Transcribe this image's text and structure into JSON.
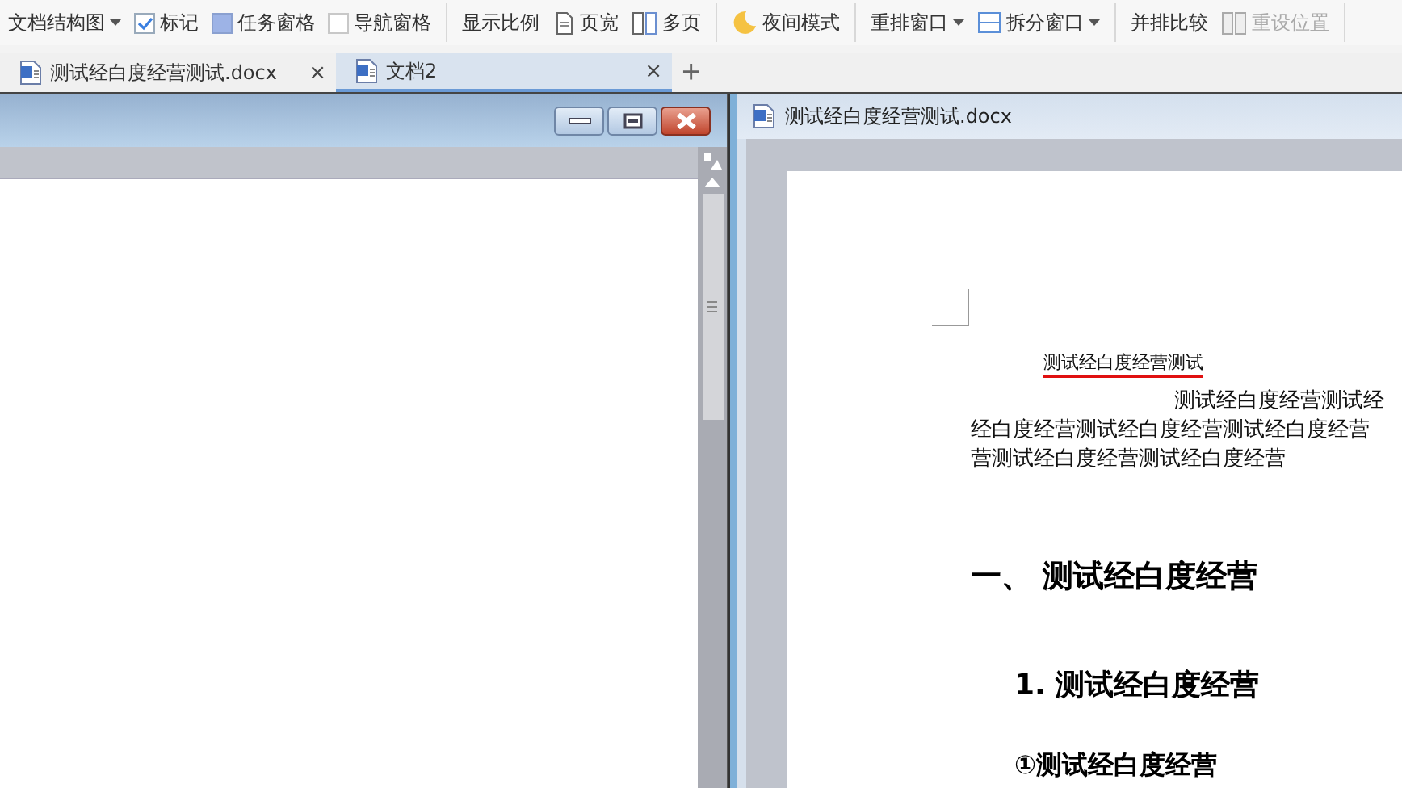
{
  "toolbar": {
    "items": [
      {
        "kind": "dropdown",
        "label": "文档结构图"
      },
      {
        "kind": "checkbox",
        "label": "标记",
        "checked": true
      },
      {
        "kind": "toggle",
        "label": "任务窗格",
        "on": true
      },
      {
        "kind": "checkbox",
        "label": "导航窗格",
        "checked": false
      },
      {
        "kind": "separator"
      },
      {
        "kind": "button",
        "label": "显示比例"
      },
      {
        "kind": "icon-button",
        "label": "页宽",
        "disabled": false
      },
      {
        "kind": "icon-button",
        "label": "多页",
        "disabled": false
      },
      {
        "kind": "separator"
      },
      {
        "kind": "icon-button",
        "label": "夜间模式",
        "disabled": false
      },
      {
        "kind": "separator"
      },
      {
        "kind": "dropdown",
        "label": "重排窗口"
      },
      {
        "kind": "icon-dropdown",
        "label": "拆分窗口"
      },
      {
        "kind": "separator"
      },
      {
        "kind": "button",
        "label": "并排比较"
      },
      {
        "kind": "icon-button",
        "label": "重设位置",
        "disabled": true
      },
      {
        "kind": "separator"
      }
    ]
  },
  "tabs": [
    {
      "label": "测试经白度经营测试.docx",
      "selected": false,
      "close": "×"
    },
    {
      "label": "文档2",
      "selected": true,
      "close": "×"
    }
  ],
  "new_tab": "+",
  "right_window": {
    "title": "测试经白度经营测试.docx",
    "document": [
      {
        "kind": "title",
        "text": "测试经白度经营测试"
      },
      {
        "kind": "body",
        "lines": [
          "测试经白度经营测试经",
          "经白度经营测试经白度经营测试经白度经营",
          "营测试经白度经营测试经白度经营"
        ]
      },
      {
        "kind": "h1",
        "text": "一、 测试经白度经营"
      },
      {
        "kind": "h2",
        "text": "1. 测试经白度经营"
      },
      {
        "kind": "h3",
        "text": "①测试经白度经营"
      }
    ]
  }
}
